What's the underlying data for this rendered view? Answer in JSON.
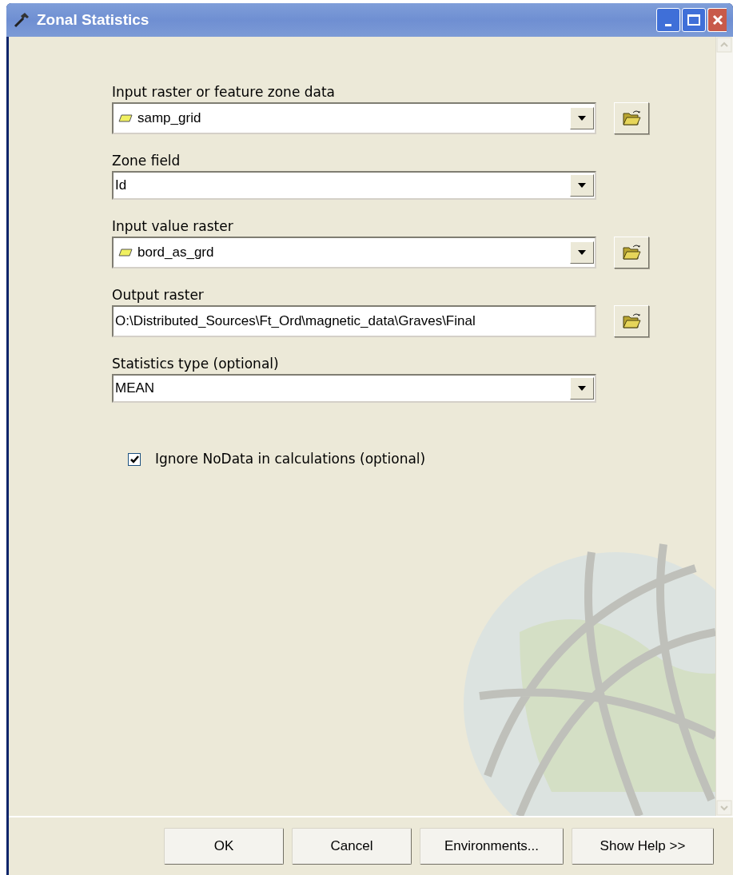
{
  "window": {
    "title": "Zonal Statistics"
  },
  "parameters": [
    {
      "label": "Input raster or feature zone data",
      "kind": "dropdown",
      "value": "samp_grid",
      "layer": true,
      "browse": true
    },
    {
      "label": "Zone field",
      "kind": "dropdown",
      "value": "Id",
      "layer": false,
      "browse": false
    },
    {
      "label": "Input value raster",
      "kind": "dropdown",
      "value": "bord_as_grd",
      "layer": true,
      "browse": true
    },
    {
      "label": "Output raster",
      "kind": "text",
      "value": "O:\\Distributed_Sources\\Ft_Ord\\magnetic_data\\Graves\\Final",
      "layer": false,
      "browse": true
    },
    {
      "label": "Statistics type (optional)",
      "kind": "dropdown",
      "value": "MEAN",
      "layer": false,
      "browse": false
    }
  ],
  "option": {
    "label": "Ignore NoData in calculations (optional)",
    "checked": true
  },
  "buttons": [
    "OK",
    "Cancel",
    "Environments...",
    "Show Help >>"
  ]
}
